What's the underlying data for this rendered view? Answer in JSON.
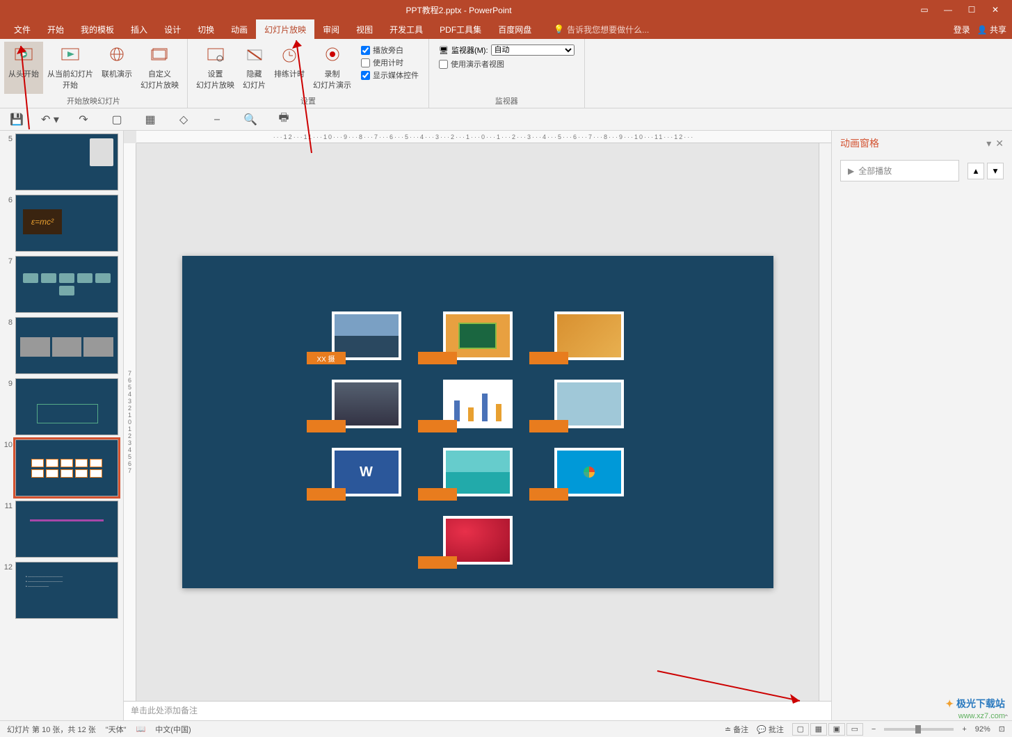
{
  "title": "PPT教程2.pptx - PowerPoint",
  "menubar": {
    "items": [
      "文件",
      "开始",
      "我的模板",
      "插入",
      "设计",
      "切换",
      "动画",
      "幻灯片放映",
      "审阅",
      "视图",
      "开发工具",
      "PDF工具集",
      "百度网盘"
    ],
    "active_index": 7,
    "tell_me": "告诉我您想要做什么...",
    "login": "登录",
    "share": "共享"
  },
  "ribbon": {
    "groups": [
      {
        "label": "开始放映幻灯片",
        "buttons": [
          "从头开始",
          "从当前幻灯片\n开始",
          "联机演示",
          "自定义\n幻灯片放映"
        ]
      },
      {
        "label": "设置",
        "buttons": [
          "设置\n幻灯片放映",
          "隐藏\n幻灯片",
          "排练计时",
          "录制\n幻灯片演示"
        ],
        "checks": [
          {
            "label": "播放旁白",
            "checked": true
          },
          {
            "label": "使用计时",
            "checked": false
          },
          {
            "label": "显示媒体控件",
            "checked": true
          }
        ]
      },
      {
        "label": "监视器",
        "monitor_label": "监视器(M):",
        "monitor_value": "自动",
        "presenter_view": {
          "label": "使用演示者视图",
          "checked": false
        }
      }
    ]
  },
  "qat": {
    "items": [
      "save",
      "undo",
      "redo",
      "new-slide",
      "table",
      "shapes",
      "align",
      "find",
      "print"
    ]
  },
  "slides": {
    "visible": [
      5,
      6,
      7,
      8,
      9,
      10,
      11,
      12
    ],
    "selected": 10,
    "thumb6_formula": "ε=mc²"
  },
  "canvas": {
    "images": [
      {
        "label": "XX 摄",
        "bg": "linear-gradient(#7aa0c4 50%,#2a4860 50%)"
      },
      {
        "label": "",
        "bg": "#e8a040"
      },
      {
        "label": "",
        "bg": "#d89030"
      },
      {
        "label": "",
        "bg": "#556070"
      },
      {
        "label": "",
        "bg": "#fff"
      },
      {
        "label": "",
        "bg": "#a0c8d8"
      },
      {
        "label": "",
        "bg": "#2b579a"
      },
      {
        "label": "",
        "bg": "linear-gradient(#6cc 50%,#2aa 50%)"
      },
      {
        "label": "",
        "bg": "#0099d8"
      },
      {
        "label": "",
        "bg": "#c41e3a"
      }
    ]
  },
  "anim_pane": {
    "title": "动画窗格",
    "play_all": "全部播放"
  },
  "notes_placeholder": "单击此处添加备注",
  "statusbar": {
    "slide_info": "幻灯片 第 10 张，共 12 张",
    "theme": "\"天体\"",
    "language": "中文(中国)",
    "notes": "备注",
    "comments": "批注",
    "zoom": "92%"
  },
  "watermark": {
    "main": "极光下载站",
    "sub": "www.xz7.com"
  }
}
